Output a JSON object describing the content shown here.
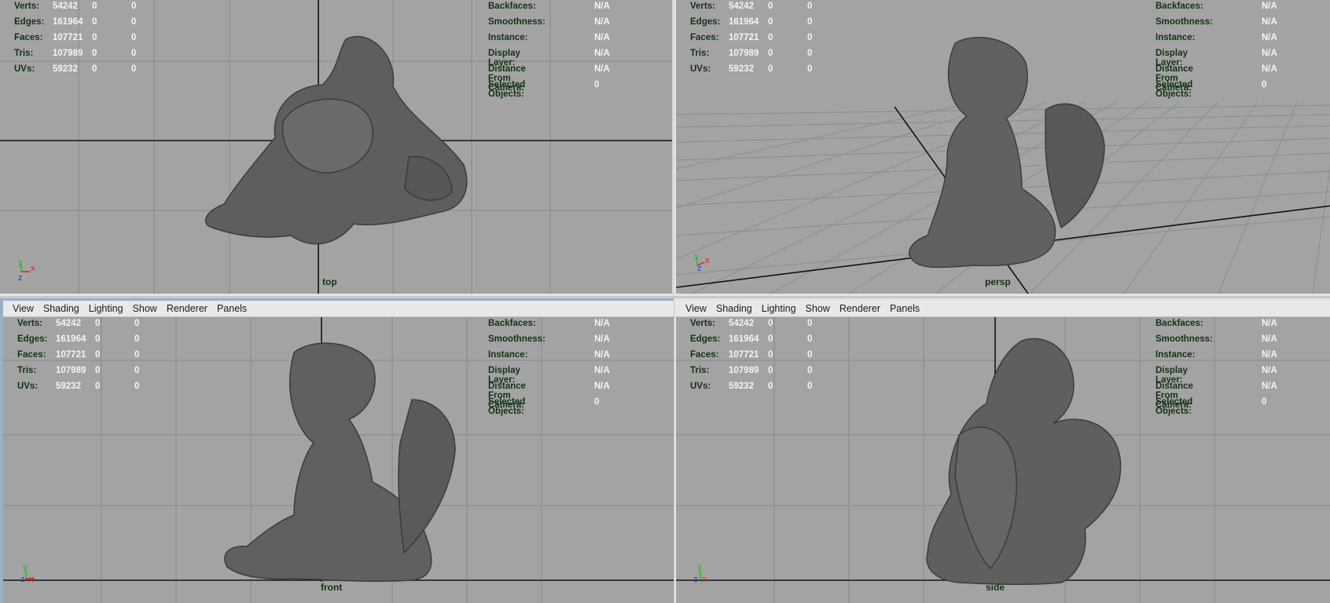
{
  "menu": [
    "View",
    "Shading",
    "Lighting",
    "Show",
    "Renderer",
    "Panels"
  ],
  "hud_left": [
    {
      "label": "Verts:",
      "value": "54242",
      "a": "0",
      "b": "0"
    },
    {
      "label": "Edges:",
      "value": "161964",
      "a": "0",
      "b": "0"
    },
    {
      "label": "Faces:",
      "value": "107721",
      "a": "0",
      "b": "0"
    },
    {
      "label": "Tris:",
      "value": "107989",
      "a": "0",
      "b": "0"
    },
    {
      "label": "UVs:",
      "value": "59232",
      "a": "0",
      "b": "0"
    }
  ],
  "hud_right": [
    {
      "label": "Backfaces:",
      "value": "N/A"
    },
    {
      "label": "Smoothness:",
      "value": "N/A"
    },
    {
      "label": "Instance:",
      "value": "N/A"
    },
    {
      "label": "Display Layer:",
      "value": "N/A"
    },
    {
      "label": "Distance From Camera:",
      "value": "N/A"
    },
    {
      "label": "Selected Objects:",
      "value": "0"
    }
  ],
  "axes": {
    "x": "x",
    "y": "y",
    "z": "z"
  },
  "colors": {
    "x_axis": "#e02020",
    "y_axis": "#20c020",
    "z_axis": "#2040e0",
    "background": "#a3a3a3",
    "hud_label": "#143214",
    "hud_value": "#f4f4f4"
  },
  "panels": [
    {
      "id": "top",
      "camera": "top"
    },
    {
      "id": "persp",
      "camera": "persp"
    },
    {
      "id": "front",
      "camera": "front"
    },
    {
      "id": "side",
      "camera": "side"
    }
  ]
}
